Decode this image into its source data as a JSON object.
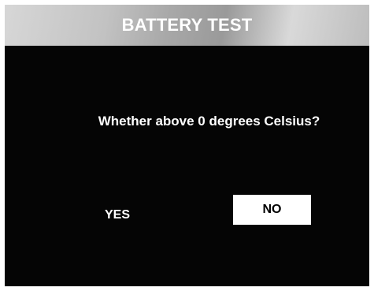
{
  "dialog": {
    "title": "BATTERY TEST",
    "question": "Whether above 0 degrees Celsius?",
    "yes_label": "YES",
    "no_label": "NO",
    "selected_option": "NO"
  }
}
